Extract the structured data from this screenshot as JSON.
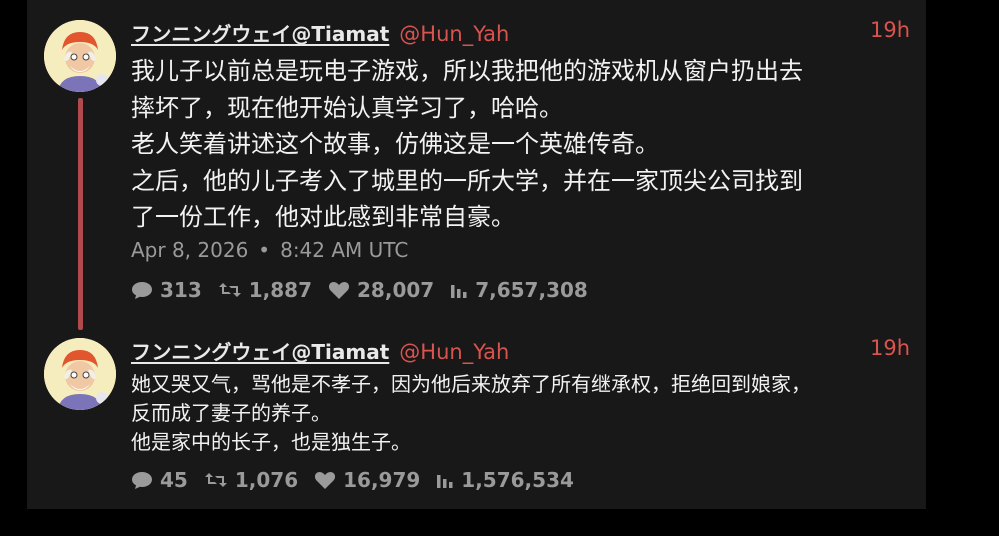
{
  "tweets": [
    {
      "display_name": "フンニングウェイ@Tiamat",
      "handle": "@Hun_Yah",
      "time": "19h",
      "body": "我儿子以前总是玩电子游戏，所以我把他的游戏机从窗户扔出去\n摔坏了，现在他开始认真学习了，哈哈。\n老人笑着讲述这个故事，仿佛这是一个英雄传奇。\n之后，他的儿子考入了城里的一所大学，并在一家顶尖公司找到\n了一份工作，他对此感到非常自豪。",
      "date": "Apr 8, 2026",
      "separator": "•",
      "clock": "8:42 AM UTC",
      "stats": {
        "replies": "313",
        "retweets": "1,887",
        "likes": "28,007",
        "views": "7,657,308"
      }
    },
    {
      "display_name": "フンニングウェイ@Tiamat",
      "handle": "@Hun_Yah",
      "time": "19h",
      "body": "她又哭又气，骂他是不孝子，因为他后来放弃了所有继承权，拒绝回到娘家，\n反而成了妻子的养子。\n他是家中的长子，也是独生子。",
      "stats": {
        "replies": "45",
        "retweets": "1,076",
        "likes": "16,979",
        "views": "1,576,534"
      }
    }
  ],
  "icons": {
    "reply": "speech-bubble-icon",
    "retweet": "retweet-icon",
    "like": "heart-icon",
    "views": "bar-chart-icon"
  },
  "colors": {
    "accent": "#d9534f",
    "thread_line": "#b04a4d",
    "panel": "#181818",
    "muted": "#9a9a9a"
  }
}
